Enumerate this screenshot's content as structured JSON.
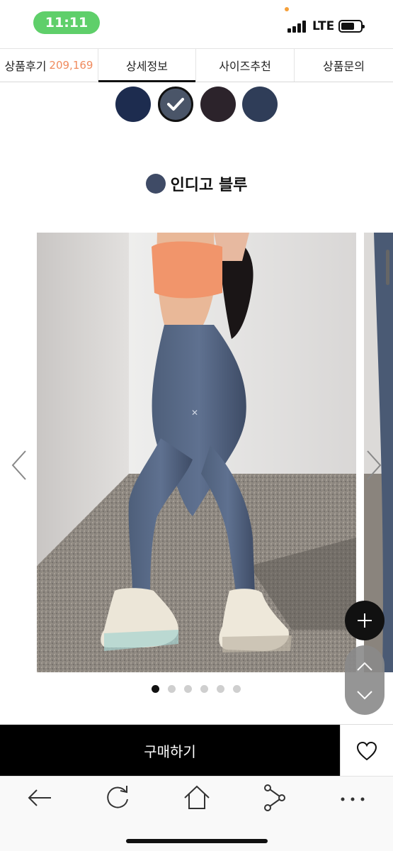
{
  "status_bar": {
    "time": "11:11",
    "network": "LTE",
    "icons": [
      "signal-icon",
      "battery-icon"
    ]
  },
  "tabs": [
    {
      "label": "상품후기",
      "count": "209,169",
      "active": false
    },
    {
      "label": "상세정보",
      "active": true
    },
    {
      "label": "사이즈추천",
      "active": false
    },
    {
      "label": "상품문의",
      "active": false
    }
  ],
  "swatches": [
    {
      "color": "#1d2c4f",
      "selected": false
    },
    {
      "color": "#4a5568",
      "selected": true
    },
    {
      "color": "#2c232b",
      "selected": false
    },
    {
      "color": "#2f3d58",
      "selected": false
    }
  ],
  "selected_color": {
    "name": "인디고 블루",
    "color": "#3f4b66"
  },
  "gallery": {
    "image_count": 6,
    "active_index": 0
  },
  "buy_bar": {
    "buy_label": "구매하기",
    "wish_icon": "heart-icon"
  },
  "toolbar": {
    "icons": [
      "back-arrow-icon",
      "refresh-icon",
      "home-icon",
      "share-icon",
      "more-icon"
    ]
  },
  "colors": {
    "count_accent": "#f08a5d",
    "status_pill": "#5fcf6a",
    "buy_button": "#000000"
  }
}
